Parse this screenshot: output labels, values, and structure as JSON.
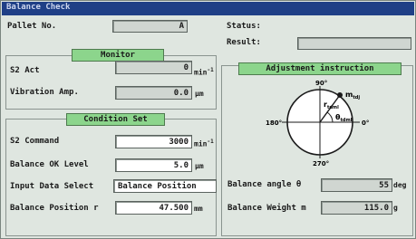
{
  "window": {
    "title": "Balance Check"
  },
  "pallet": {
    "label": "Pallet No.",
    "value": "A"
  },
  "status": {
    "label": "Status:",
    "result_label": "Result:",
    "result_value": ""
  },
  "monitor": {
    "header": "Monitor",
    "s2_act": {
      "label": "S2 Act",
      "value": "0",
      "unit": "min",
      "unit_sup": "-1"
    },
    "vibration": {
      "label": "Vibration Amp.",
      "value": "0.0",
      "unit": "μm"
    }
  },
  "condition": {
    "header": "Condition Set",
    "s2_command": {
      "label": "S2 Command",
      "value": "3000",
      "unit": "min",
      "unit_sup": "-1"
    },
    "balance_ok": {
      "label": "Balance OK Level",
      "value": "5.0",
      "unit": "μm"
    },
    "input_select": {
      "label": "Input Data Select",
      "value": "Balance Position"
    },
    "balance_pos": {
      "label": "Balance Position r",
      "value": "47.500",
      "unit": "mm"
    }
  },
  "adjustment": {
    "header": "Adjustment instruction",
    "diagram": {
      "label_top": "90°",
      "label_left": "180°",
      "label_right": "0°",
      "label_bottom": "270°",
      "label_weight": "m",
      "label_weight_sub": "tdj",
      "label_radius": "r",
      "label_radius_sub": "tdml",
      "label_angle": "θ",
      "label_angle_sub": "tdml"
    },
    "balance_angle": {
      "label": "Balance angle θ",
      "value": "55",
      "unit": "deg"
    },
    "balance_weight": {
      "label": "Balance Weight m",
      "value": "115.0",
      "unit": "g"
    }
  }
}
